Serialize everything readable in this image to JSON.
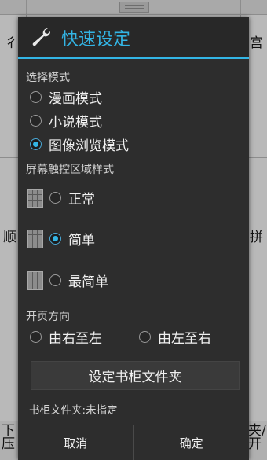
{
  "dialog": {
    "title": "快速设定",
    "title_icon": "wrench-icon",
    "accent_color": "#33b5e5",
    "mode_section": {
      "label": "选择模式",
      "options": [
        {
          "label": "漫画模式",
          "checked": false
        },
        {
          "label": "小说模式",
          "checked": false
        },
        {
          "label": "图像浏览模式",
          "checked": true
        }
      ]
    },
    "touch_section": {
      "label": "屏幕触控区域样式",
      "options": [
        {
          "label": "正常",
          "checked": false,
          "icon": "grid-layout-normal-icon"
        },
        {
          "label": "简单",
          "checked": true,
          "icon": "grid-layout-simple-icon"
        },
        {
          "label": "最简单",
          "checked": false,
          "icon": "grid-layout-simplest-icon"
        }
      ]
    },
    "direction_section": {
      "label": "开页方向",
      "options": [
        {
          "label": "由右至左",
          "checked": false
        },
        {
          "label": "由左至右",
          "checked": false
        }
      ]
    },
    "folder_button": "设定书柜文件夹",
    "folder_status": "书柜文件夹:未指定",
    "cancel_label": "取消",
    "ok_label": "确定"
  }
}
